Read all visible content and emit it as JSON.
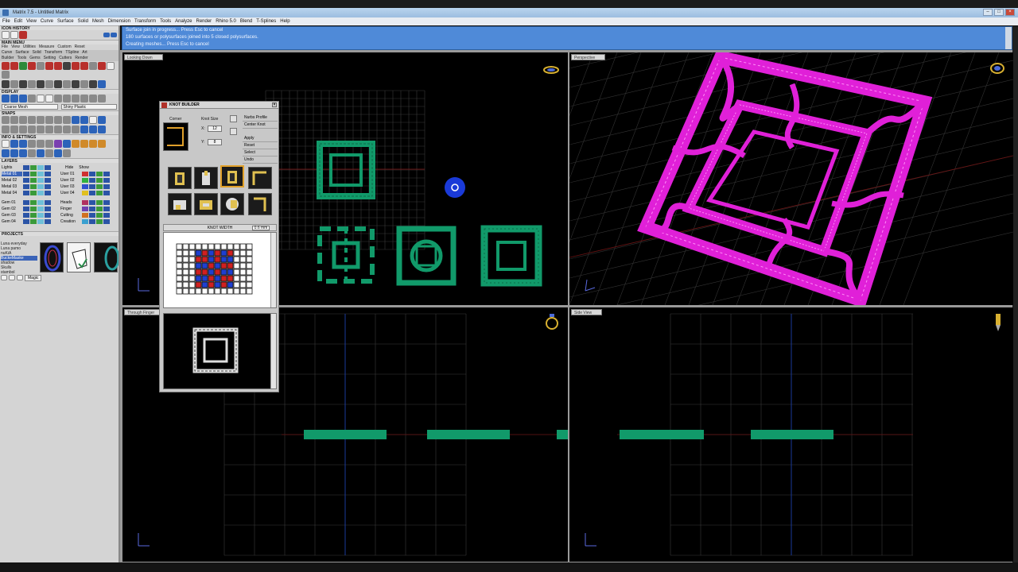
{
  "window": {
    "title": "Matrix 7.5 - Untitled Matrix"
  },
  "menus": [
    "File",
    "Edit",
    "View",
    "Curve",
    "Surface",
    "Solid",
    "Mesh",
    "Dimension",
    "Transform",
    "Tools",
    "Analyze",
    "Render",
    "Rhino 5.0",
    "Blend",
    "T-Splines",
    "Help"
  ],
  "command": {
    "lines": [
      "Surface join in progress... Press Esc to cancel",
      "180 surfaces or polysurfaces joined into 5 closed polysurfaces.",
      "Creating meshes... Press Esc to cancel"
    ]
  },
  "left_panel": {
    "icon_history": "ICON HISTORY",
    "main_menu": "MAIN MENU",
    "main_menu_sub": [
      "File",
      "View",
      "Utilities",
      "Measure",
      "Custom",
      "Reset"
    ],
    "main_menu_row1": [
      "Curve",
      "Surface",
      "Solid",
      "Transform",
      "TSpline",
      "Art"
    ],
    "main_menu_row2": [
      "Builder",
      "Tools",
      "Gems",
      "Setting",
      "Cutters",
      "Render"
    ],
    "display": "DISPLAY",
    "display_combo": [
      "Coarse Mesh",
      "Shiny Plastic"
    ],
    "snaps": "SNAPS",
    "info_settings": "INFO & SETTINGS",
    "layers_title": "LAYERS",
    "layers": [
      "Lights",
      "Metal 01",
      "Metal 02",
      "Metal 03",
      "Metal 04",
      "Gem 01",
      "Gem 02",
      "Gem 03",
      "Gem 04"
    ],
    "materials_header": [
      "Hide",
      "Show"
    ],
    "materials": [
      "User 01",
      "User 02",
      "User 03",
      "User 04",
      "Heads",
      "Finger",
      "Cutting",
      "Creation"
    ],
    "material_colors": [
      "#d03030",
      "#30b040",
      "#3050d0",
      "#e0c020",
      "#b03060",
      "#7040b0",
      "#d07020",
      "#3aa0d0"
    ],
    "projects_title": "PROJECTS",
    "projects": [
      "Luna everyday",
      "Luna pamo",
      "nuKiA",
      "BuckeMaske",
      "shadow",
      "Skulls",
      "stambol"
    ],
    "magic": "Magic"
  },
  "viewports": {
    "top": "Looking Down",
    "perspective": "Perspective",
    "front": "Through Finger",
    "side": "Side View"
  },
  "knot_builder": {
    "title": "KNOT BUILDER",
    "corner_label": "Corner",
    "knot_size_label": "Knot Size",
    "x_label": "X:",
    "x_value": "12",
    "y_label": "Y:",
    "y_value": "8",
    "right_options": [
      "Nurbs Profile",
      "Center Knot"
    ],
    "actions": [
      "Apply",
      "Reset",
      "Select",
      "Undo"
    ],
    "knot_width_label": "KNOT WIDTH",
    "knot_width_value": "0.6 mm"
  },
  "colors": {
    "knot_green": "#119a6a",
    "wire_magenta": "#e020d8",
    "command_blue": "#4f8ad8",
    "grid": "#3a3a3a",
    "axis_red": "#8a1818",
    "axis_blue": "#1a3a9a"
  }
}
